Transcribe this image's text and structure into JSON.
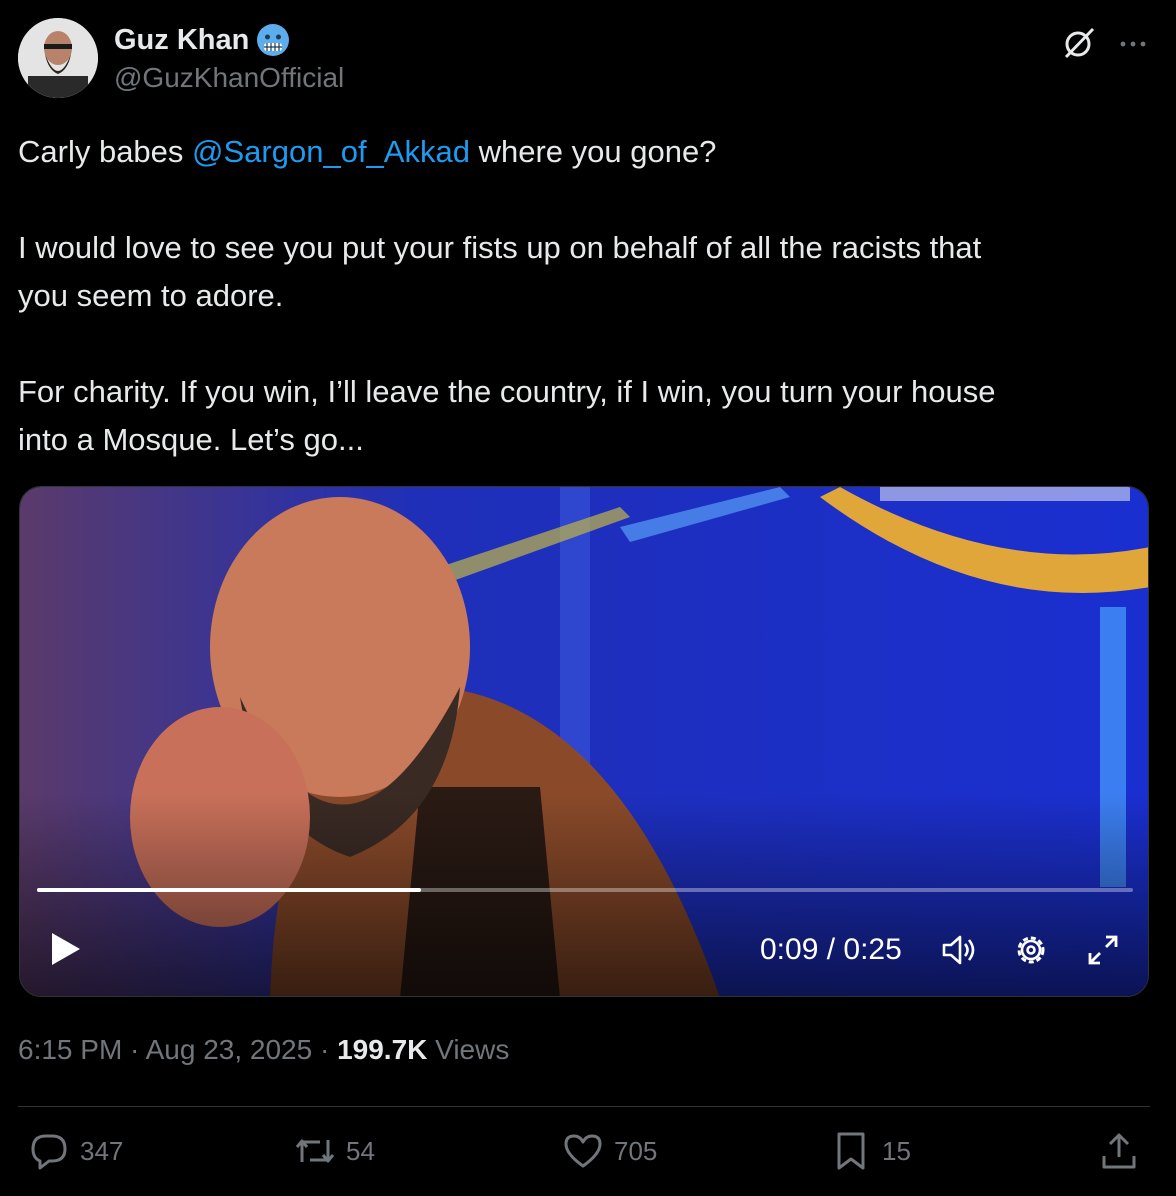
{
  "author": {
    "display_name": "Guz Khan",
    "handle": "@GuzKhanOfficial",
    "badge_emoji": "cold-face-emoji"
  },
  "header_icons": [
    "grok-icon",
    "more-icon"
  ],
  "tweet": {
    "line1_pre": "Carly babes ",
    "mention": "@Sargon_of_Akkad",
    "line1_post": " where you gone?",
    "para2_line1": "I would love to see you put your fists up on behalf of all the racists that",
    "para2_line2": "you seem to adore.",
    "para3_line1": "For charity. If you win, I’ll leave the country, if I win, you turn your house",
    "para3_line2": "into a Mosque. Let’s go..."
  },
  "video": {
    "time_display": "0:09 / 0:25",
    "progress": 0.35,
    "controls": [
      "play-icon",
      "volume-icon",
      "settings-icon",
      "fullscreen-icon"
    ]
  },
  "meta": {
    "timestamp": "6:15 PM · Aug 23, 2025 · ",
    "views_count": "199.7K",
    "views_label": " Views"
  },
  "actions": {
    "replies": "347",
    "reposts": "54",
    "likes": "705",
    "bookmarks": "15"
  },
  "colors": {
    "background": "#000000",
    "text": "#e7e9ea",
    "muted": "#71767b",
    "link": "#1d9bf0",
    "divider": "#2f3336"
  }
}
